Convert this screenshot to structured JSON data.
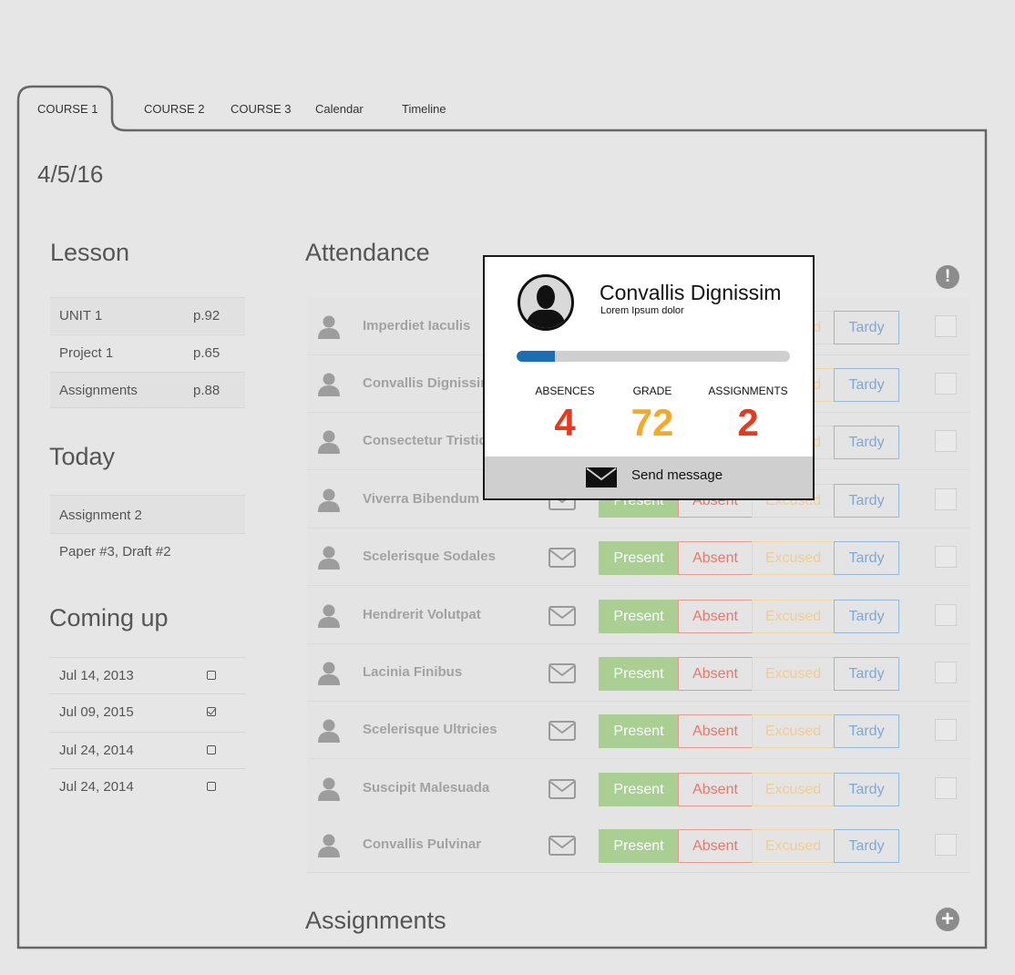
{
  "tabs": [
    {
      "label": "COURSE 1",
      "active": true
    },
    {
      "label": "COURSE 2",
      "active": false
    },
    {
      "label": "COURSE 3",
      "active": false
    },
    {
      "label": "Calendar",
      "active": false
    },
    {
      "label": "Timeline",
      "active": false
    }
  ],
  "date": "4/5/16",
  "lesson": {
    "title": "Lesson",
    "items": [
      {
        "label": "UNIT 1",
        "page": "p.92"
      },
      {
        "label": "Project 1",
        "page": "p.65"
      },
      {
        "label": "Assignments",
        "page": "p.88"
      }
    ]
  },
  "today": {
    "title": "Today",
    "items": [
      {
        "label": "Assignment 2"
      },
      {
        "label": "Paper #3, Draft #2"
      }
    ]
  },
  "coming_up": {
    "title": "Coming up",
    "items": [
      {
        "date": "Jul 14, 2013",
        "checked": false
      },
      {
        "date": "Jul 09, 2015",
        "checked": true
      },
      {
        "date": "Jul 24, 2014",
        "checked": false
      },
      {
        "date": "Jul 24, 2014",
        "checked": false
      }
    ]
  },
  "attendance": {
    "title": "Attendance",
    "alert_icon": "exclamation-circle-icon",
    "buttons": {
      "present": "Present",
      "absent": "Absent",
      "excused": "Excused",
      "tardy": "Tardy"
    },
    "students": [
      {
        "name": "Imperdiet Iaculis"
      },
      {
        "name": "Convallis Dignissim"
      },
      {
        "name": "Consectetur Tristique"
      },
      {
        "name": "Viverra Bibendum"
      },
      {
        "name": "Scelerisque Sodales"
      },
      {
        "name": "Hendrerit Volutpat"
      },
      {
        "name": "Lacinia Finibus"
      },
      {
        "name": "Scelerisque Ultricies"
      },
      {
        "name": "Suscipit Malesuada"
      },
      {
        "name": "Convallis Pulvinar"
      }
    ]
  },
  "assignments": {
    "title": "Assignments",
    "add_icon": "plus-circle-icon"
  },
  "popup": {
    "name": "Convallis Dignissim",
    "subtitle": "Lorem Ipsum dolor",
    "progress": 0.14,
    "stats": [
      {
        "label": "ABSENCES",
        "value": "4",
        "color": "#e8391f"
      },
      {
        "label": "GRADE",
        "value": "72",
        "color": "#f7a824"
      },
      {
        "label": "ASSIGNMENTS",
        "value": "2",
        "color": "#e8391f"
      }
    ],
    "send_label": "Send message"
  },
  "colors": {
    "present": "#a9cf93",
    "absent": "#e6786b",
    "excused": "#f1cd8e",
    "tardy": "#80a8d3",
    "progress": "#1b6db6"
  }
}
